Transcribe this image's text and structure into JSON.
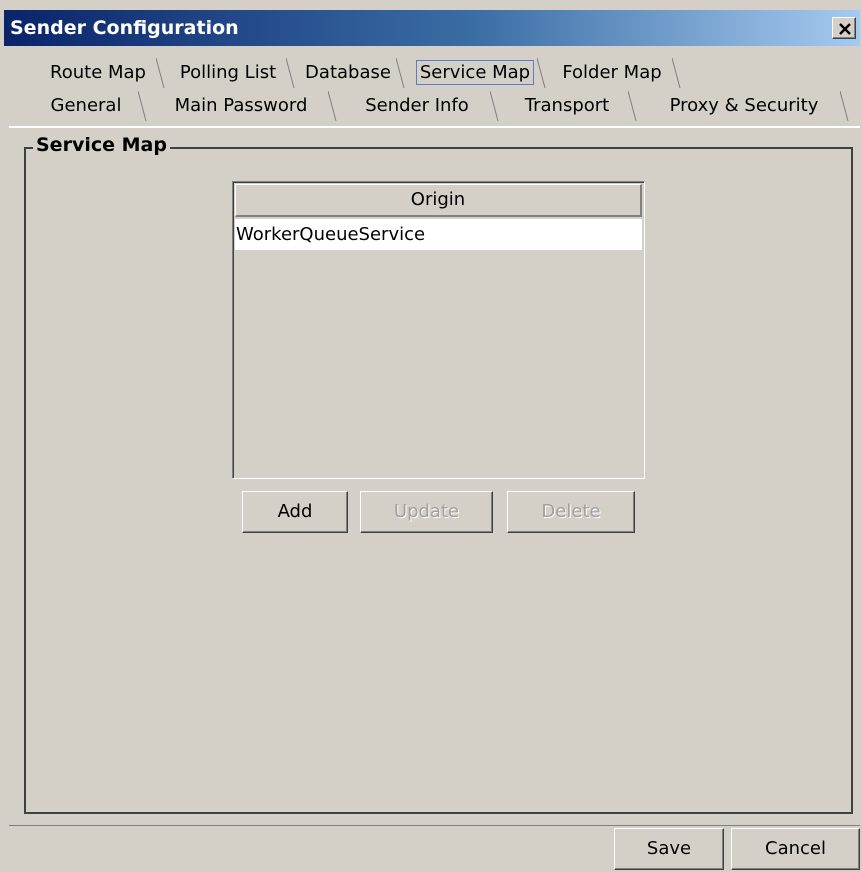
{
  "window": {
    "title": "Sender Configuration",
    "close_icon": "close-icon"
  },
  "tabs": {
    "row1": [
      {
        "label": "Route Map",
        "active": false
      },
      {
        "label": "Polling List",
        "active": false
      },
      {
        "label": "Database",
        "active": false
      },
      {
        "label": "Service Map",
        "active": true
      },
      {
        "label": "Folder Map",
        "active": false
      }
    ],
    "row2": [
      {
        "label": "General",
        "active": false
      },
      {
        "label": "Main Password",
        "active": false
      },
      {
        "label": "Sender Info",
        "active": false
      },
      {
        "label": "Transport",
        "active": false
      },
      {
        "label": "Proxy & Security",
        "active": false
      }
    ]
  },
  "panel": {
    "group_title": "Service Map",
    "list": {
      "column_header": "Origin",
      "rows": [
        "WorkerQueueService"
      ]
    },
    "buttons": {
      "add": "Add",
      "update": "Update",
      "delete": "Delete"
    }
  },
  "footer": {
    "save": "Save",
    "cancel": "Cancel"
  },
  "colors": {
    "title_gradient_start": "#0a246a",
    "title_gradient_end": "#a6caf0",
    "face": "#d4d0c8",
    "selection_outline": "#5b7ec0"
  }
}
